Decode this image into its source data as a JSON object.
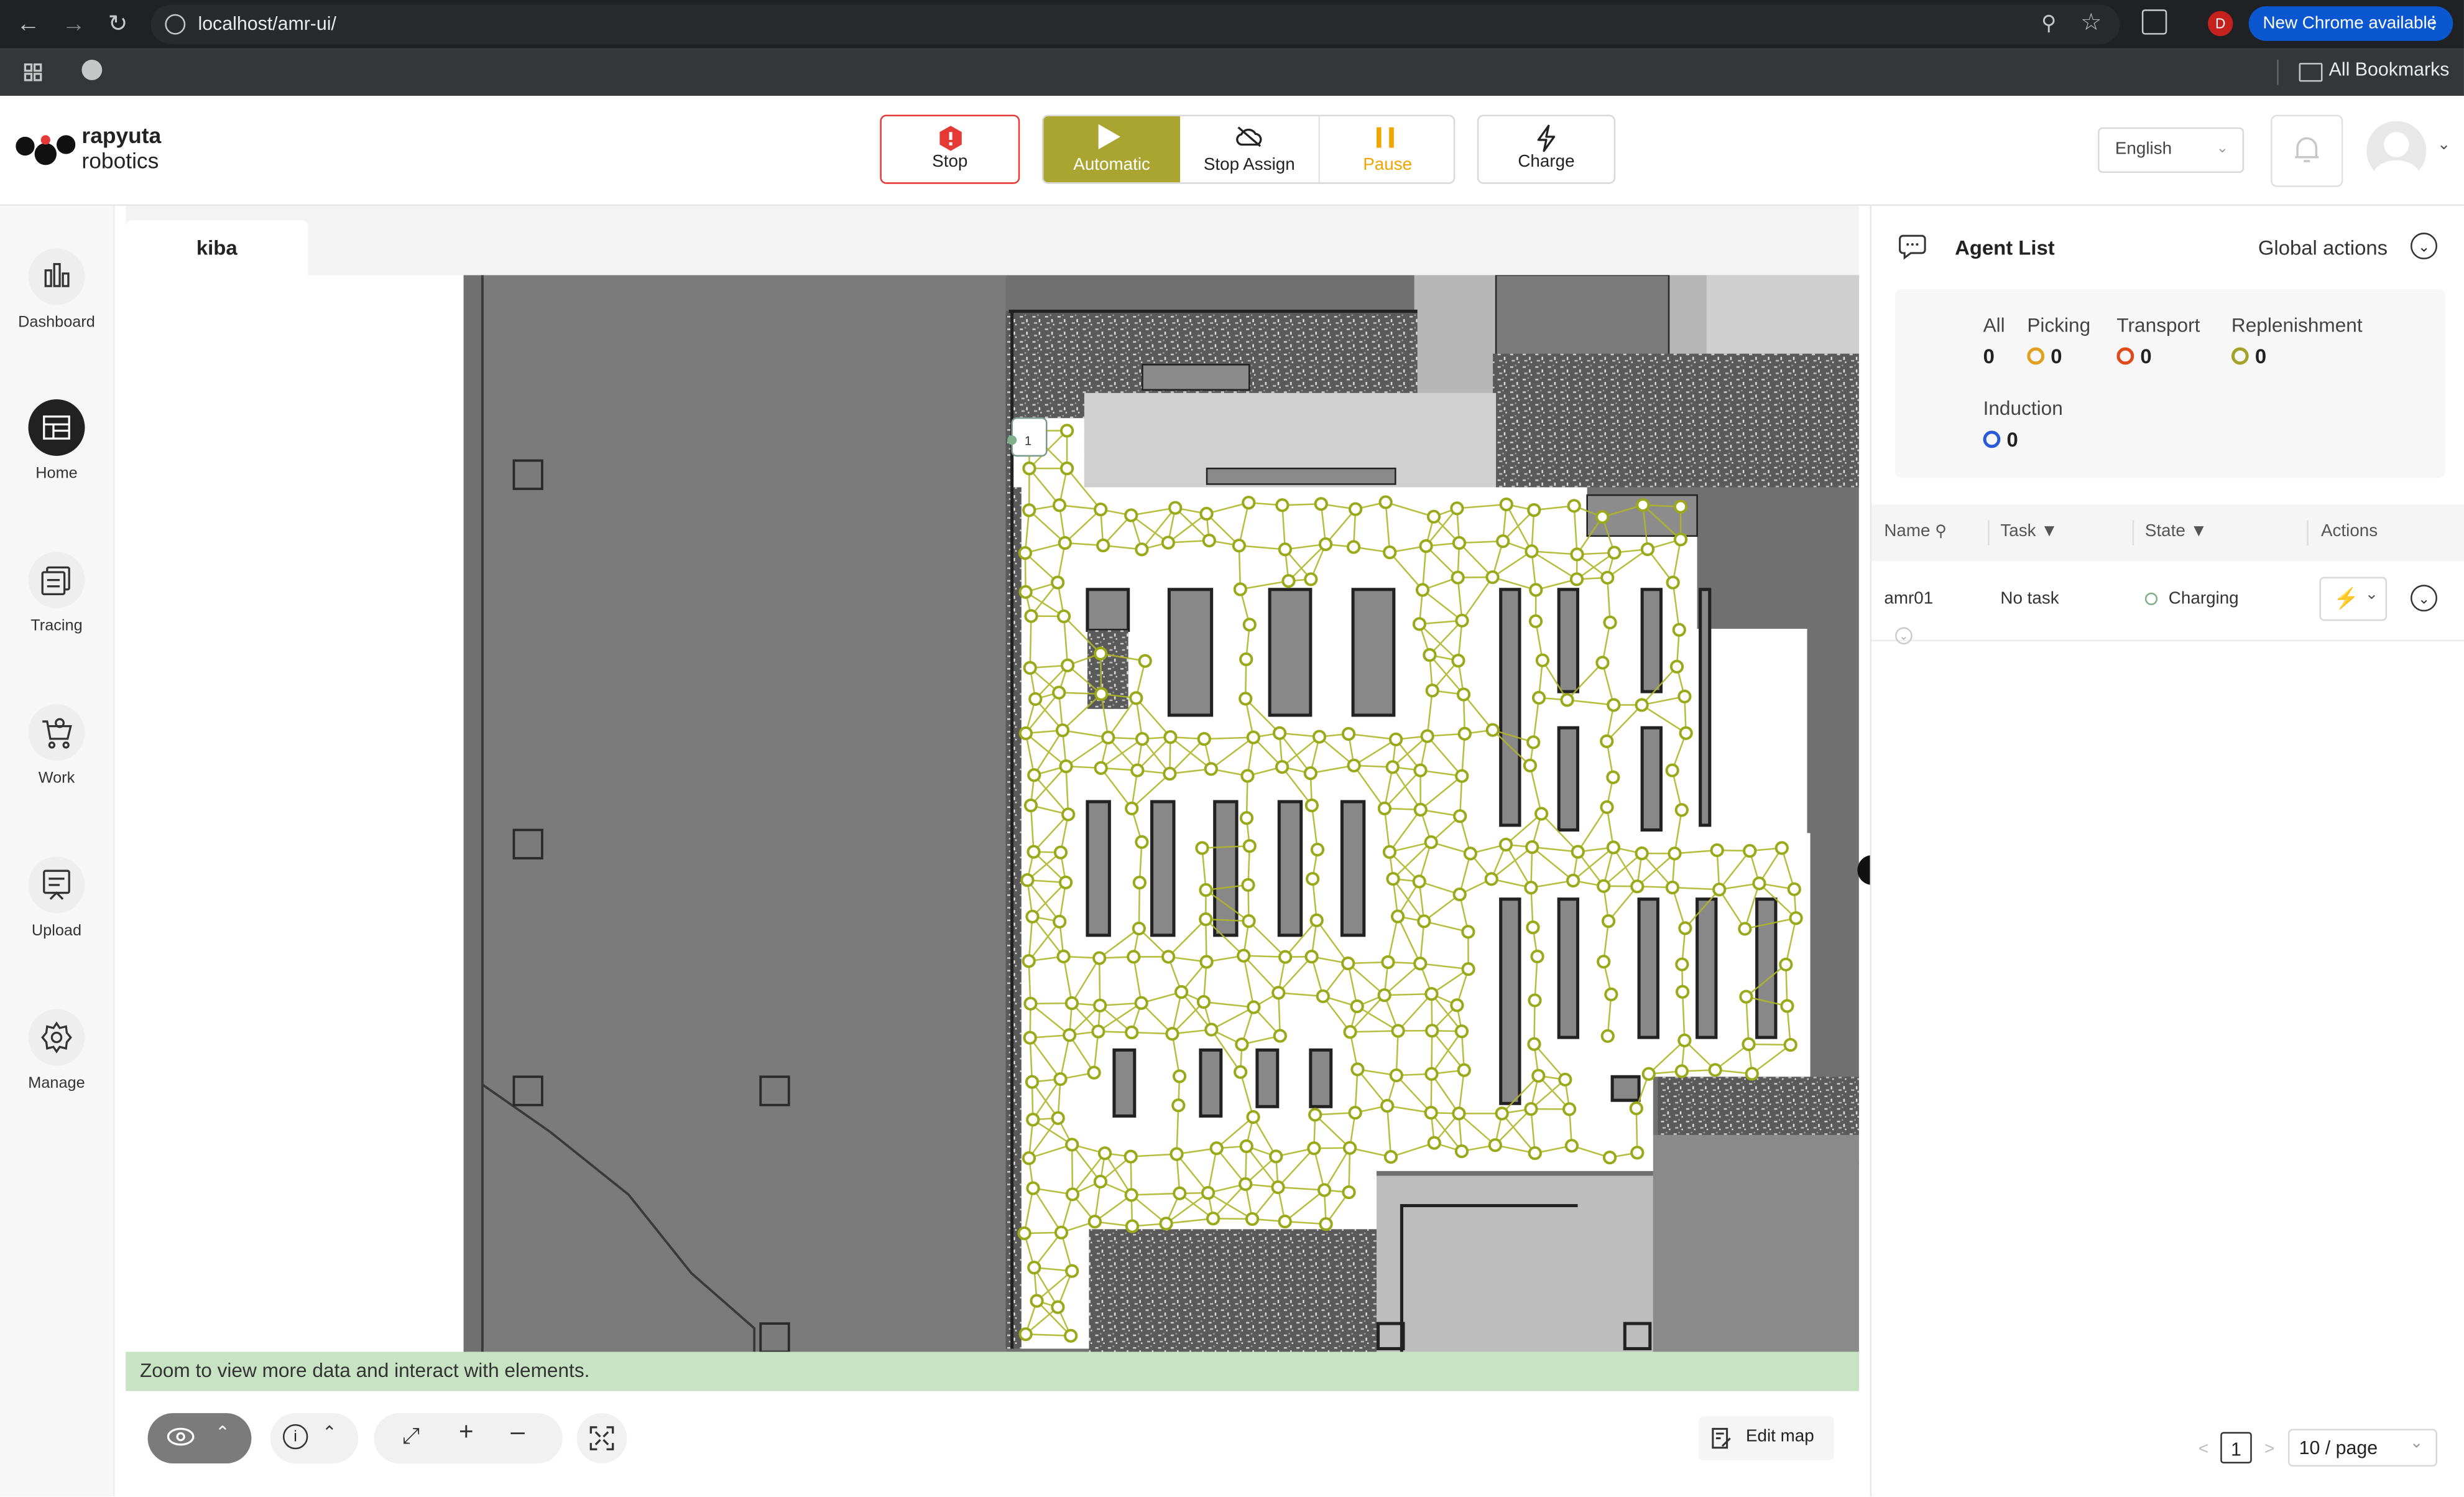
{
  "browser": {
    "url": "localhost/amr-ui/",
    "new_chrome": "New Chrome available",
    "bookmarks": "All Bookmarks",
    "profile_initial": "D"
  },
  "brand": {
    "line1": "rapyuta",
    "line2": "robotics"
  },
  "controls": {
    "stop": "Stop",
    "automatic": "Automatic",
    "stop_assign": "Stop Assign",
    "pause": "Pause",
    "charge": "Charge"
  },
  "language": "English",
  "sidebar": {
    "items": [
      {
        "label": "Dashboard",
        "icon": "bar-chart-icon"
      },
      {
        "label": "Home",
        "icon": "map-icon",
        "active": true
      },
      {
        "label": "Tracing",
        "icon": "tracing-icon"
      },
      {
        "label": "Work",
        "icon": "cart-icon"
      },
      {
        "label": "Upload",
        "icon": "upload-icon"
      },
      {
        "label": "Manage",
        "icon": "gear-icon"
      }
    ]
  },
  "map": {
    "tab": "kiba",
    "marker_label": "1",
    "zoom_message": "Zoom to view more data and interact with elements.",
    "edit_map": "Edit map"
  },
  "agent_panel": {
    "title": "Agent List",
    "global_actions": "Global actions",
    "categories": [
      {
        "label": "All",
        "count": "0",
        "color": ""
      },
      {
        "label": "Picking",
        "count": "0",
        "color": "#e0a020"
      },
      {
        "label": "Transport",
        "count": "0",
        "color": "#e04a1a"
      },
      {
        "label": "Replenishment",
        "count": "0",
        "color": "#a3a32a"
      },
      {
        "label": "Induction",
        "count": "0",
        "color": "#2a5bd7"
      }
    ],
    "columns": {
      "name": "Name",
      "task": "Task",
      "state": "State",
      "actions": "Actions"
    },
    "rows": [
      {
        "name": "amr01",
        "task": "No task",
        "state": "Charging",
        "state_color": "#7fb08a"
      }
    ],
    "pagination": {
      "page": "1",
      "page_size": "10 / page"
    }
  },
  "colors": {
    "accent": "#a9a530",
    "stop_red": "#e53935",
    "pause_amber": "#f0a500",
    "node": "#9aa91a"
  }
}
